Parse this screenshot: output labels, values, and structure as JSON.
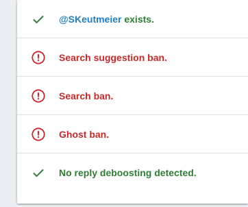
{
  "results": {
    "handle": "@SKeutmeier",
    "exists_suffix": " exists.",
    "items": [
      {
        "label": "Search suggestion ban.",
        "status": "fail",
        "icon": "error-icon"
      },
      {
        "label": "Search ban.",
        "status": "fail",
        "icon": "error-icon"
      },
      {
        "label": "Ghost ban.",
        "status": "fail",
        "icon": "error-icon"
      },
      {
        "label": "No reply deboosting detected.",
        "status": "pass",
        "icon": "check-icon"
      }
    ]
  },
  "colors": {
    "success": "#2e7d32",
    "error": "#c62828",
    "handle_link": "#1f7dc2"
  }
}
